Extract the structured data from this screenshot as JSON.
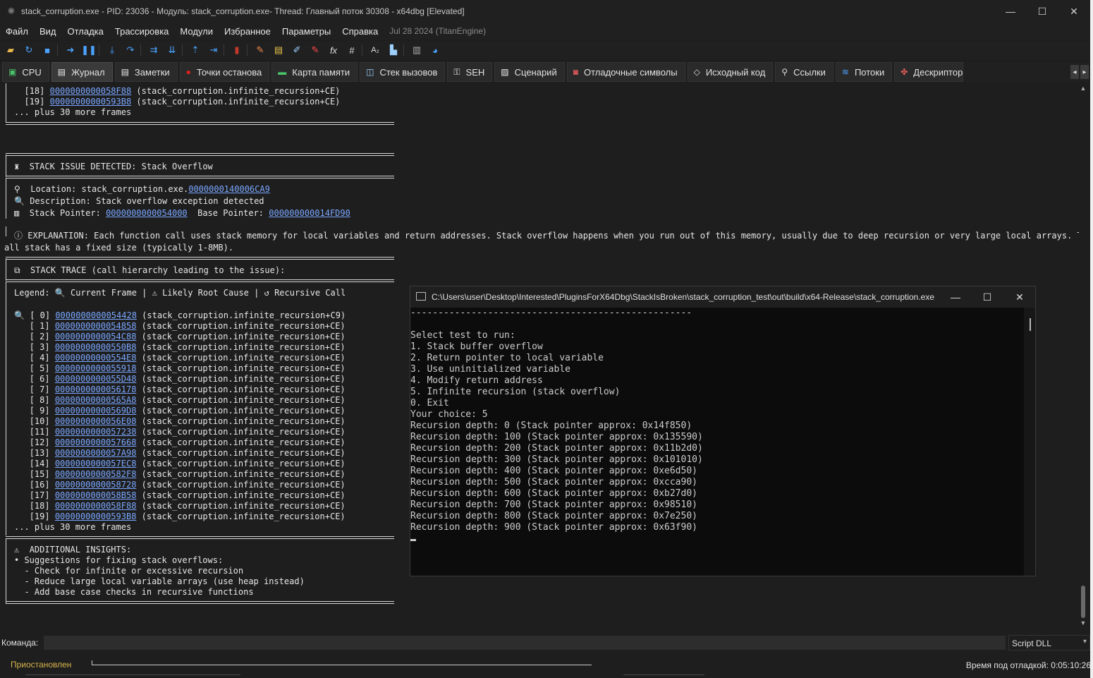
{
  "window": {
    "title": "stack_corruption.exe - PID: 23036 - Модуль: stack_corruption.exe- Thread: Главный поток 30308 - x64dbg [Elevated]",
    "minimize": "—",
    "maximize": "☐",
    "close": "✕"
  },
  "menu": {
    "items": [
      "Файл",
      "Вид",
      "Отладка",
      "Трассировка",
      "Модули",
      "Избранное",
      "Параметры",
      "Справка"
    ],
    "date": "Jul 28 2024 (TitanEngine)"
  },
  "tabs": [
    "CPU",
    "Журнал",
    "Заметки",
    "Точки останова",
    "Карта памяти",
    "Стек вызовов",
    "SEH",
    "Сценарий",
    "Отладочные символы",
    "Исходный код",
    "Ссылки",
    "Потоки",
    "Дескрипторы"
  ],
  "log": {
    "top_frames": [
      {
        "idx": "[18]",
        "addr": "0000000000058F88",
        "sym": "(stack_corruption.infinite_recursion+CE)"
      },
      {
        "idx": "[19]",
        "addr": "00000000000593B8",
        "sym": "(stack_corruption.infinite_recursion+CE)"
      }
    ],
    "more_frames": "... plus 30 more frames",
    "issue_header": "STACK ISSUE DETECTED: Stack Overflow",
    "location_label": "Location: stack_corruption.exe.",
    "location_addr": "0000000140006CA9",
    "description": "Description: Stack overflow exception detected",
    "sp_label": "Stack Pointer: ",
    "sp_addr": "0000000000054000",
    "bp_label": "  Base Pointer: ",
    "bp_addr": "000000000014FD90",
    "explanation_1": "EXPLANATION: Each function call uses stack memory for local variables and return addresses. Stack overflow happens when you run out of this memory, usually due to deep recursion or very large local arrays. The c",
    "explanation_2": "all stack has a fixed size (typically 1-8MB).",
    "trace_header": "STACK TRACE (call hierarchy leading to the issue):",
    "legend": "Legend:",
    "legend_current": "Current Frame |",
    "legend_root": "Likely Root Cause |",
    "legend_recursive": "Recursive Call",
    "frames": [
      {
        "idx": "[ 0]",
        "addr": "0000000000054428",
        "sym": "(stack_corruption.infinite_recursion+C9)"
      },
      {
        "idx": "[ 1]",
        "addr": "0000000000054858",
        "sym": "(stack_corruption.infinite_recursion+CE)"
      },
      {
        "idx": "[ 2]",
        "addr": "0000000000054C88",
        "sym": "(stack_corruption.infinite_recursion+CE)"
      },
      {
        "idx": "[ 3]",
        "addr": "00000000000550B8",
        "sym": "(stack_corruption.infinite_recursion+CE)"
      },
      {
        "idx": "[ 4]",
        "addr": "00000000000554E8",
        "sym": "(stack_corruption.infinite_recursion+CE)"
      },
      {
        "idx": "[ 5]",
        "addr": "0000000000055918",
        "sym": "(stack_corruption.infinite_recursion+CE)"
      },
      {
        "idx": "[ 6]",
        "addr": "0000000000055D48",
        "sym": "(stack_corruption.infinite_recursion+CE)"
      },
      {
        "idx": "[ 7]",
        "addr": "0000000000056178",
        "sym": "(stack_corruption.infinite_recursion+CE)"
      },
      {
        "idx": "[ 8]",
        "addr": "00000000000565A8",
        "sym": "(stack_corruption.infinite_recursion+CE)"
      },
      {
        "idx": "[ 9]",
        "addr": "00000000000569D8",
        "sym": "(stack_corruption.infinite_recursion+CE)"
      },
      {
        "idx": "[10]",
        "addr": "0000000000056E08",
        "sym": "(stack_corruption.infinite_recursion+CE)"
      },
      {
        "idx": "[11]",
        "addr": "0000000000057238",
        "sym": "(stack_corruption.infinite_recursion+CE)"
      },
      {
        "idx": "[12]",
        "addr": "0000000000057668",
        "sym": "(stack_corruption.infinite_recursion+CE)"
      },
      {
        "idx": "[13]",
        "addr": "0000000000057A98",
        "sym": "(stack_corruption.infinite_recursion+CE)"
      },
      {
        "idx": "[14]",
        "addr": "0000000000057EC8",
        "sym": "(stack_corruption.infinite_recursion+CE)"
      },
      {
        "idx": "[15]",
        "addr": "00000000000582F8",
        "sym": "(stack_corruption.infinite_recursion+CE)"
      },
      {
        "idx": "[16]",
        "addr": "0000000000058728",
        "sym": "(stack_corruption.infinite_recursion+CE)"
      },
      {
        "idx": "[17]",
        "addr": "0000000000058B58",
        "sym": "(stack_corruption.infinite_recursion+CE)"
      },
      {
        "idx": "[18]",
        "addr": "0000000000058F88",
        "sym": "(stack_corruption.infinite_recursion+CE)"
      },
      {
        "idx": "[19]",
        "addr": "00000000000593B8",
        "sym": "(stack_corruption.infinite_recursion+CE)"
      }
    ],
    "insights_header": "ADDITIONAL INSIGHTS:",
    "insights": [
      "• Suggestions for fixing stack overflows:",
      "  - Check for infinite or excessive recursion",
      "  - Reduce large local variable arrays (use heap instead)",
      "  - Add base case checks in recursive functions"
    ]
  },
  "command": {
    "label": "Команда:",
    "value": "",
    "engine": "Script DLL"
  },
  "status": {
    "state": "Приостановлен",
    "time": "Время под отладкой: 0:05:10:26"
  },
  "console": {
    "title": "C:\\Users\\user\\Desktop\\Interested\\PluginsForX64Dbg\\StackIsBroken\\stack_corruption_test\\out\\build\\x64-Release\\stack_corruption.exe",
    "lines": [
      "---------------------------------------------------",
      "",
      "Select test to run:",
      "1. Stack buffer overflow",
      "2. Return pointer to local variable",
      "3. Use uninitialized variable",
      "4. Modify return address",
      "5. Infinite recursion (stack overflow)",
      "0. Exit",
      "Your choice: 5",
      "Recursion depth: 0 (Stack pointer approx: 0x14f850)",
      "Recursion depth: 100 (Stack pointer approx: 0x135590)",
      "Recursion depth: 200 (Stack pointer approx: 0x11b2d0)",
      "Recursion depth: 300 (Stack pointer approx: 0x101010)",
      "Recursion depth: 400 (Stack pointer approx: 0xe6d50)",
      "Recursion depth: 500 (Stack pointer approx: 0xcca90)",
      "Recursion depth: 600 (Stack pointer approx: 0xb27d0)",
      "Recursion depth: 700 (Stack pointer approx: 0x98510)",
      "Recursion depth: 800 (Stack pointer approx: 0x7e250)",
      "Recursion depth: 900 (Stack pointer approx: 0x63f90)"
    ]
  }
}
